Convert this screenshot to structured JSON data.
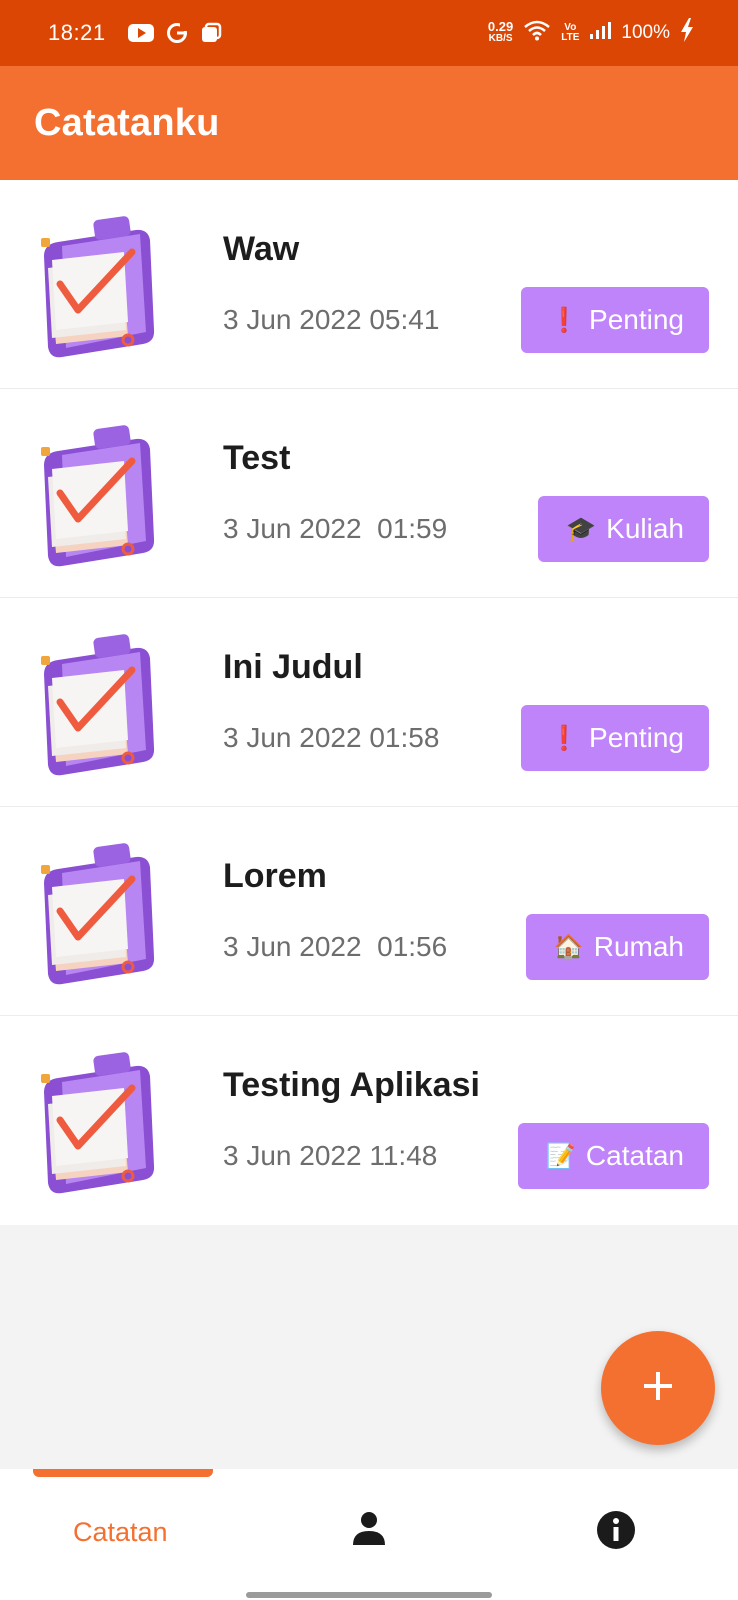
{
  "status_bar": {
    "time": "18:21",
    "left_icons": [
      "youtube-icon",
      "g-icon",
      "square-app-icon"
    ],
    "net_speed_value": "0.29",
    "net_speed_unit": "KB/S",
    "volte_top": "Vo",
    "volte_bottom": "LTE",
    "battery": "100%",
    "icons": [
      "wifi-icon",
      "signal-icon",
      "charging-icon"
    ]
  },
  "app_bar": {
    "title": "Catatanku"
  },
  "notes": [
    {
      "title": "Waw",
      "date": "3 Jun 2022 05:41",
      "tag_emoji": "❗",
      "tag_label": "Penting"
    },
    {
      "title": "Test",
      "date": "3 Jun 2022  01:59",
      "tag_emoji": "🎓",
      "tag_label": "Kuliah"
    },
    {
      "title": "Ini Judul",
      "date": "3 Jun 2022 01:58",
      "tag_emoji": "❗",
      "tag_label": "Penting"
    },
    {
      "title": "Lorem",
      "date": "3 Jun 2022  01:56",
      "tag_emoji": "🏠",
      "tag_label": "Rumah"
    },
    {
      "title": "Testing Aplikasi",
      "date": "3 Jun 2022 11:48",
      "tag_emoji": "📝",
      "tag_label": "Catatan"
    }
  ],
  "fab": {
    "icon": "plus-icon"
  },
  "bottom_nav": {
    "items": [
      {
        "label": "Catatan",
        "active": true
      },
      {
        "icon": "person-icon"
      },
      {
        "icon": "info-icon"
      }
    ]
  },
  "colors": {
    "status_bar": "#dc4605",
    "accent": "#f47030",
    "tag": "#c084fa",
    "background": "#f3f3f3"
  }
}
